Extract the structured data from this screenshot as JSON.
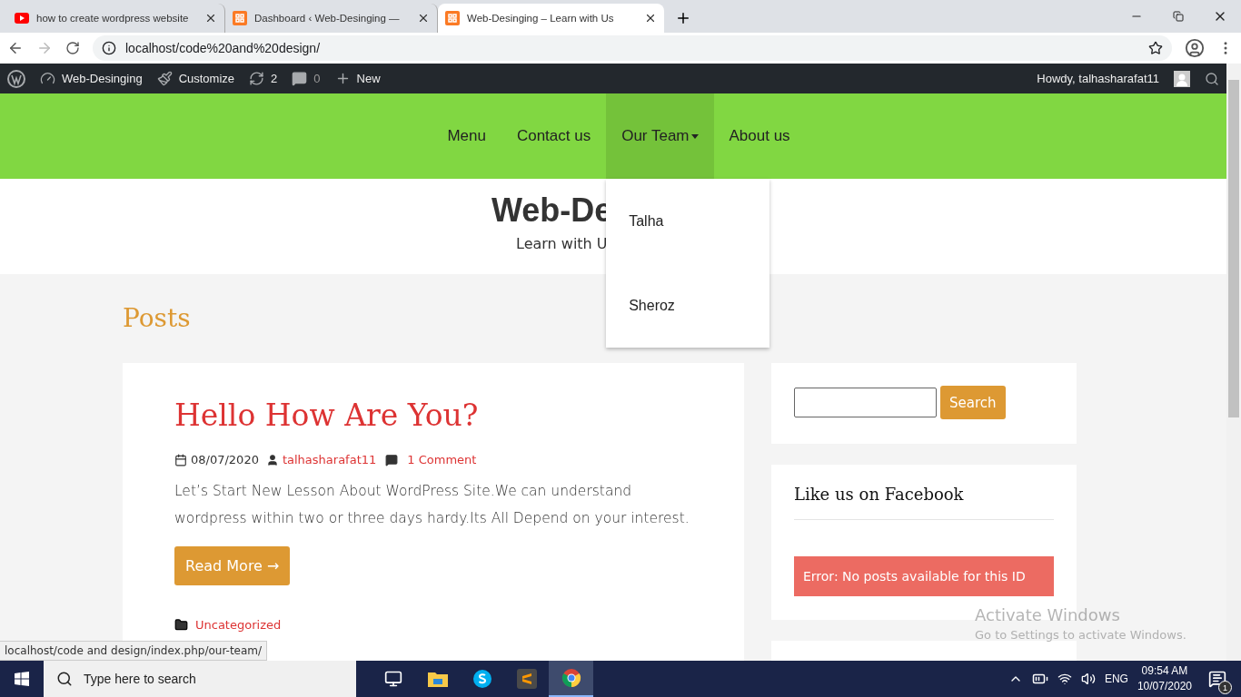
{
  "browser": {
    "tabs": [
      {
        "kind": "youtube",
        "title": "how to create wordpress website",
        "selected": false
      },
      {
        "kind": "xampp",
        "title": "Dashboard ‹ Web-Desinging —",
        "selected": false
      },
      {
        "kind": "xampp",
        "title": "Web-Desinging – Learn with Us",
        "selected": true
      }
    ],
    "address": "localhost/code%20and%20design/"
  },
  "admin_bar": {
    "items": [
      {
        "kind": "site",
        "label": "Web-Desinging"
      },
      {
        "kind": "customize",
        "label": "Customize"
      },
      {
        "kind": "updates",
        "label": "2"
      },
      {
        "kind": "comments",
        "label": "0"
      },
      {
        "kind": "new",
        "label": "New"
      }
    ],
    "howdy": "Howdy, talhasharafat11"
  },
  "nav": {
    "items": [
      {
        "label": "Menu",
        "selected": false,
        "has_dropdown": false
      },
      {
        "label": "Contact us",
        "selected": false,
        "has_dropdown": false
      },
      {
        "label": "Our Team",
        "selected": true,
        "has_dropdown": true
      },
      {
        "label": "About us",
        "selected": false,
        "has_dropdown": false
      }
    ],
    "dropdown": [
      "Talha",
      "Sheroz"
    ]
  },
  "header": {
    "title": "Web-De",
    "tagline": "Learn with U"
  },
  "posts_heading": "Posts",
  "post": {
    "title": "Hello How Are You?",
    "date": "08/07/2020",
    "author": "talhasharafat11",
    "comments": "1 Comment",
    "excerpt": "Let’s Start New Lesson About WordPress Site.We can understand wordpress within two or three days hardy.Its All Depend on your interest.",
    "button": "Read More →",
    "category": "Uncategorized"
  },
  "sidebar": {
    "search_button": "Search",
    "widget_title": "Like us on Facebook",
    "error": "Error: No posts available for this ID"
  },
  "status_url": "localhost/code and design/index.php/our-team/",
  "activation": {
    "title": "Activate Windows",
    "subtitle": "Go to Settings to activate Windows."
  },
  "taskbar": {
    "search_placeholder": "Type here to search",
    "apps": [
      {
        "kind": "taskview",
        "selected": false
      },
      {
        "kind": "explorer",
        "selected": false
      },
      {
        "kind": "skype",
        "selected": false
      },
      {
        "kind": "sublime",
        "selected": false
      },
      {
        "kind": "chrome",
        "selected": true
      }
    ],
    "language": "ENG",
    "time": "09:54 AM",
    "date": "10/07/2020",
    "notifications": "1"
  }
}
